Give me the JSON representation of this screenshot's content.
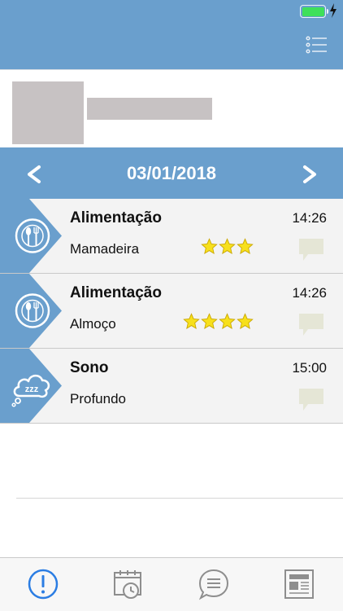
{
  "status_bar": {
    "battery_color": "#3ee05a"
  },
  "header": {
    "background": "#6a9fcd",
    "menu_icon": "list-menu-icon"
  },
  "date_nav": {
    "date": "03/01/2018",
    "prev_glyph": "<",
    "next_glyph": ">"
  },
  "events": [
    {
      "title": "Alimentação",
      "time": "14:26",
      "detail": "Mamadeira",
      "icon": "plate-fork-spoon-icon",
      "rating": 3
    },
    {
      "title": "Alimentação",
      "time": "14:26",
      "detail": "Almoço",
      "icon": "plate-fork-spoon-icon",
      "rating": 4
    },
    {
      "title": "Sono",
      "time": "15:00",
      "detail": "Profundo",
      "icon": "sleep-cloud-icon",
      "rating": 0
    }
  ],
  "tab_bar": {
    "tabs": [
      {
        "icon": "alert-icon",
        "active": true
      },
      {
        "icon": "calendar-clock-icon",
        "active": false
      },
      {
        "icon": "chat-bubble-icon",
        "active": false
      },
      {
        "icon": "newspaper-icon",
        "active": false
      }
    ],
    "active_color": "#2b7de3",
    "inactive_color": "#8e8e8e"
  }
}
